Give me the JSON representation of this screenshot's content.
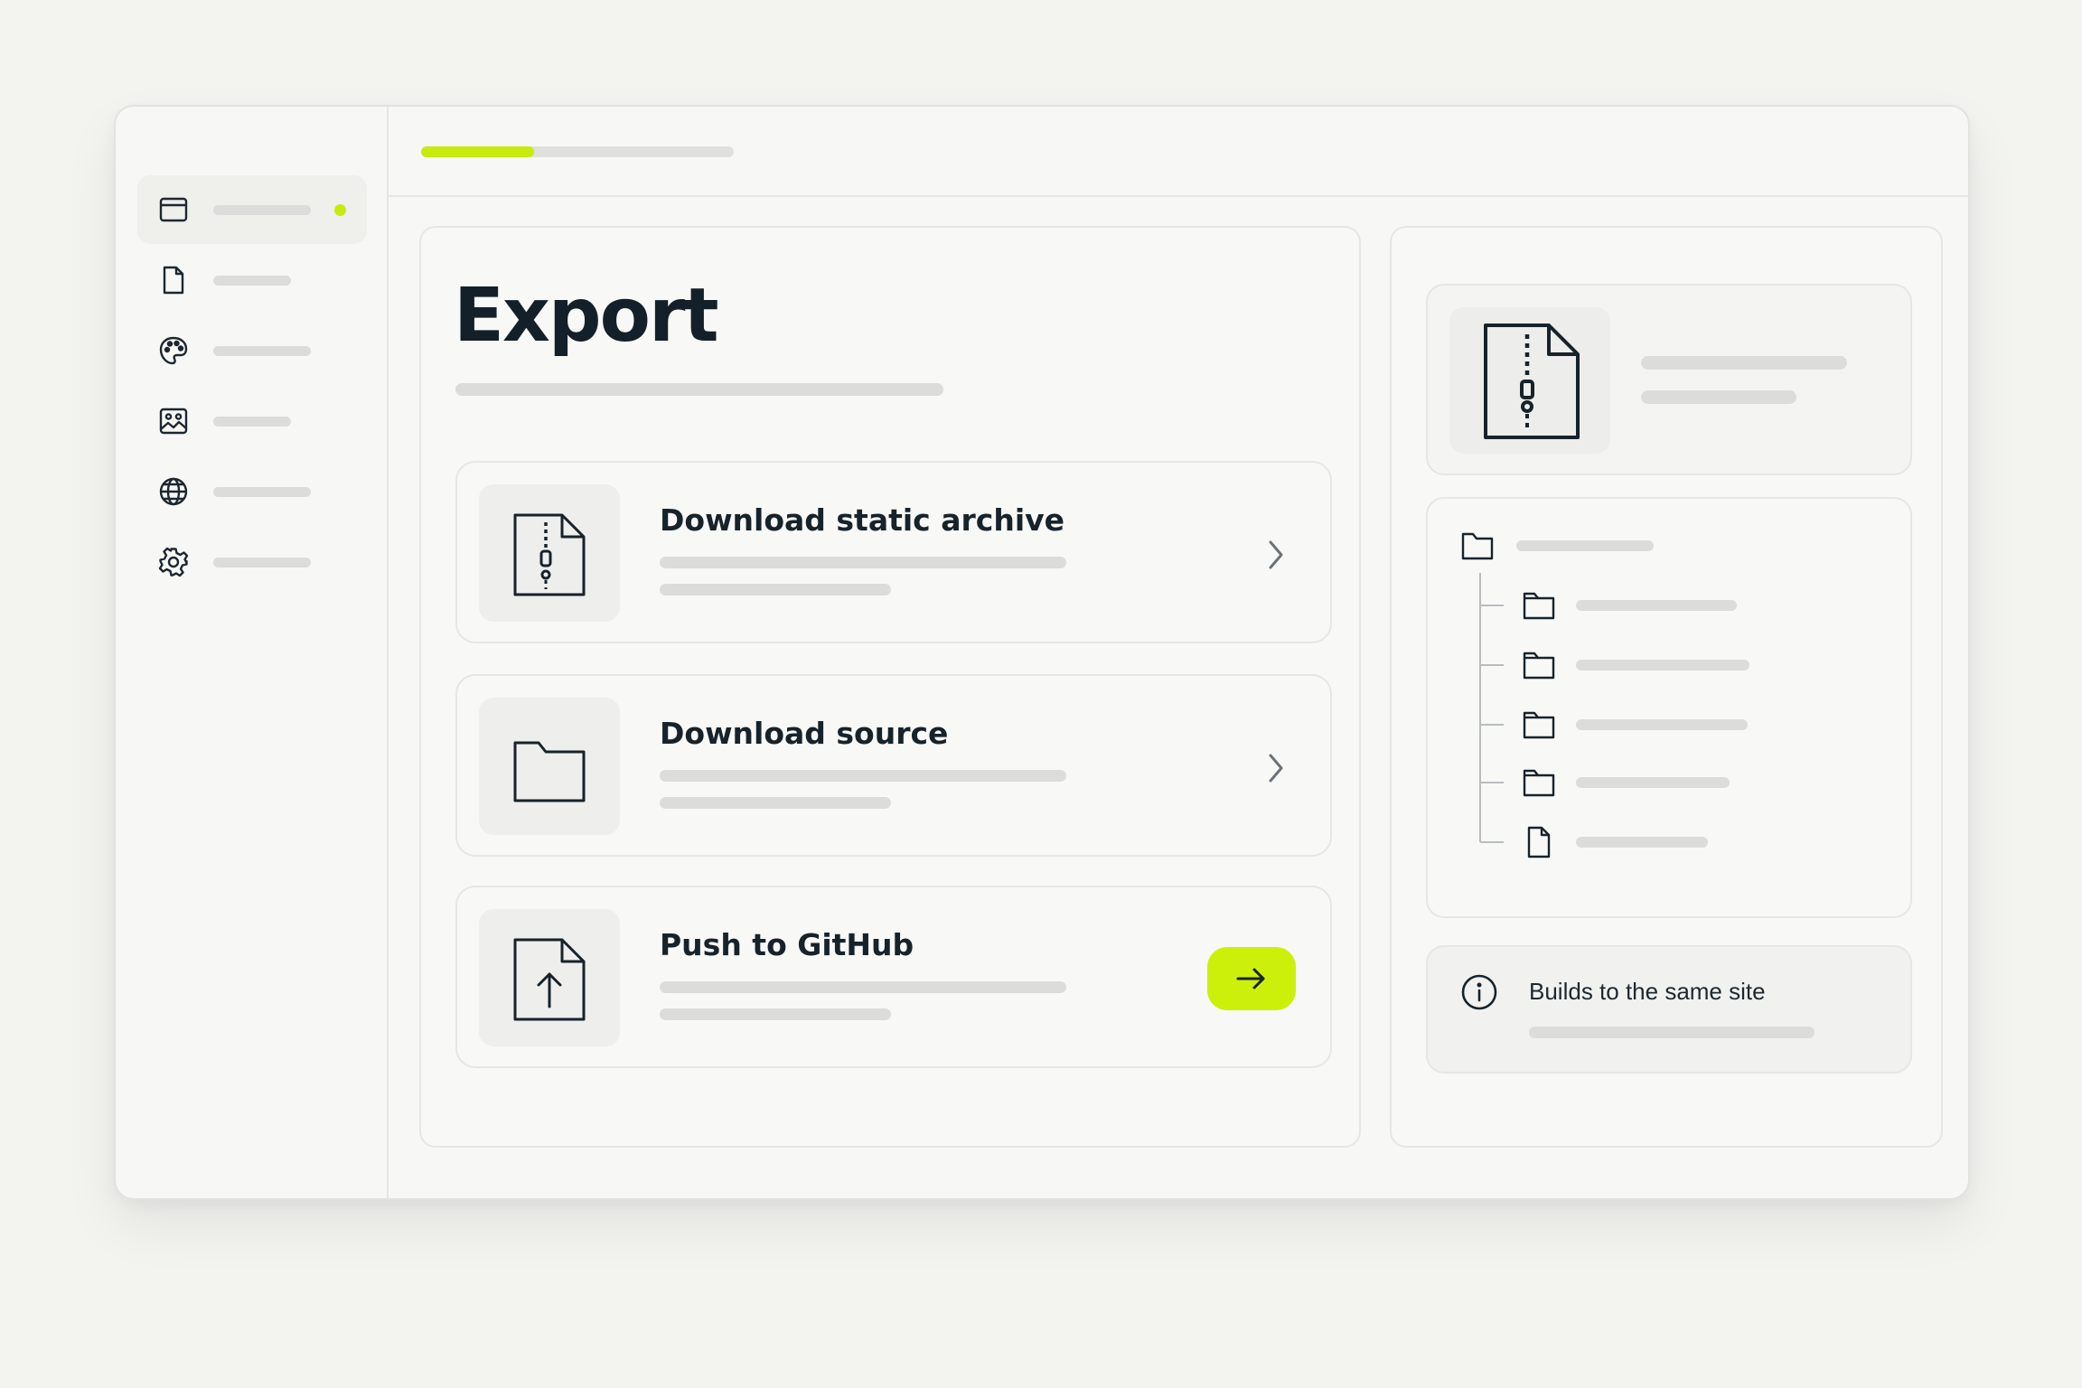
{
  "colors": {
    "accent": "#c9ea0e",
    "text": "#17232b",
    "placeholder": "#dcdcda",
    "border": "#e6e6e3"
  },
  "sidebar": {
    "items": [
      {
        "icon": "browser-window-icon",
        "active": true
      },
      {
        "icon": "file-icon",
        "active": false
      },
      {
        "icon": "palette-icon",
        "active": false
      },
      {
        "icon": "image-icon",
        "active": false
      },
      {
        "icon": "globe-icon",
        "active": false
      },
      {
        "icon": "gear-icon",
        "active": false
      }
    ]
  },
  "topbar": {
    "progress_fraction": 0.36
  },
  "main": {
    "title": "Export",
    "options": [
      {
        "title": "Download static archive",
        "icon": "zip-file-icon",
        "action": "chevron-right-icon"
      },
      {
        "title": "Download source",
        "icon": "folder-icon",
        "action": "chevron-right-icon"
      },
      {
        "title": "Push to GitHub",
        "icon": "file-upload-icon",
        "action": "arrow-right-icon"
      }
    ]
  },
  "side": {
    "preview_icon": "zip-file-icon",
    "tree": [
      {
        "type": "folder",
        "level": 0
      },
      {
        "type": "folder",
        "level": 1
      },
      {
        "type": "folder",
        "level": 1
      },
      {
        "type": "folder",
        "level": 1
      },
      {
        "type": "folder",
        "level": 1
      },
      {
        "type": "file",
        "level": 1
      }
    ],
    "info_text": "Builds to the same site",
    "info_icon": "info-icon"
  }
}
